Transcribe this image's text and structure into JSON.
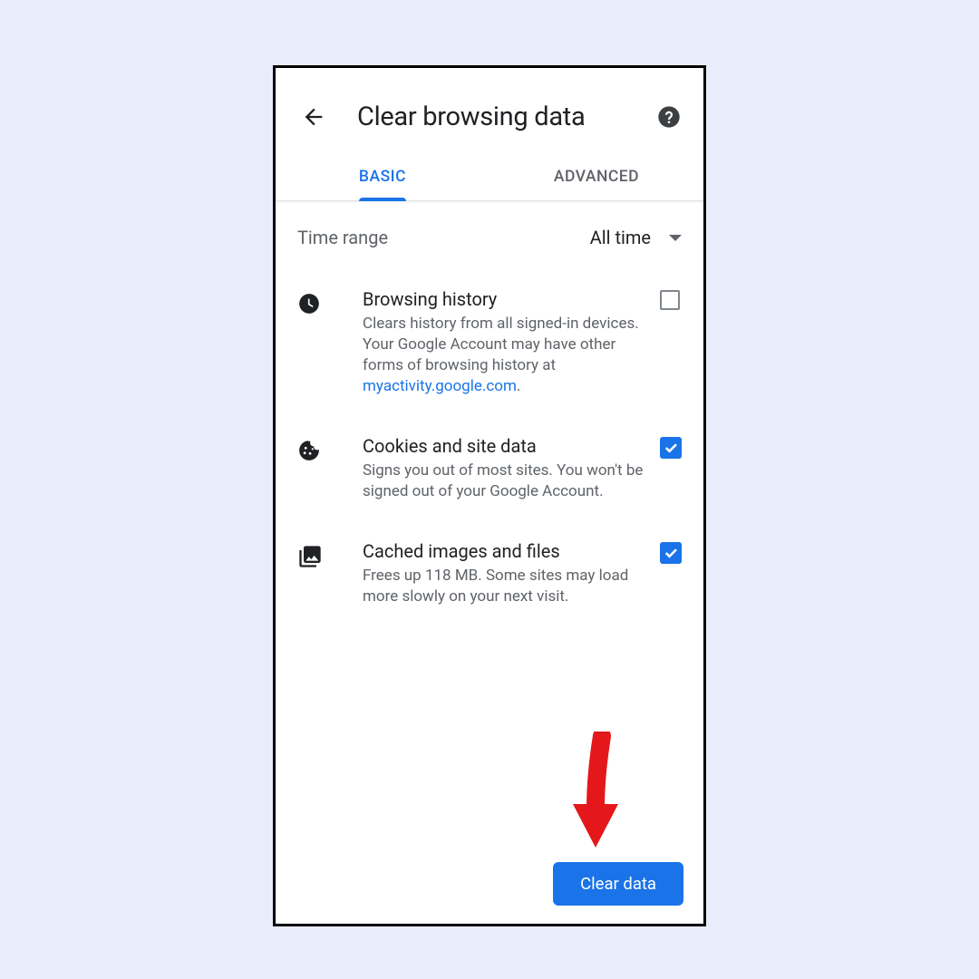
{
  "header": {
    "title": "Clear browsing data"
  },
  "tabs": {
    "basic": "BASIC",
    "advanced": "ADVANCED"
  },
  "timerange": {
    "label": "Time range",
    "value": "All time"
  },
  "items": [
    {
      "title": "Browsing history",
      "desc_prefix": "Clears history from all signed-in devices. Your Google Account may have other forms of browsing history at ",
      "link_text": "myactivity.google.com",
      "desc_suffix": ".",
      "checked": false
    },
    {
      "title": "Cookies and site data",
      "desc": "Signs you out of most sites. You won't be signed out of your Google Account.",
      "checked": true
    },
    {
      "title": "Cached images and files",
      "desc": "Frees up 118 MB. Some sites may load more slowly on your next visit.",
      "checked": true
    }
  ],
  "footer": {
    "clear_button": "Clear data"
  },
  "colors": {
    "accent": "#1a73e8"
  }
}
